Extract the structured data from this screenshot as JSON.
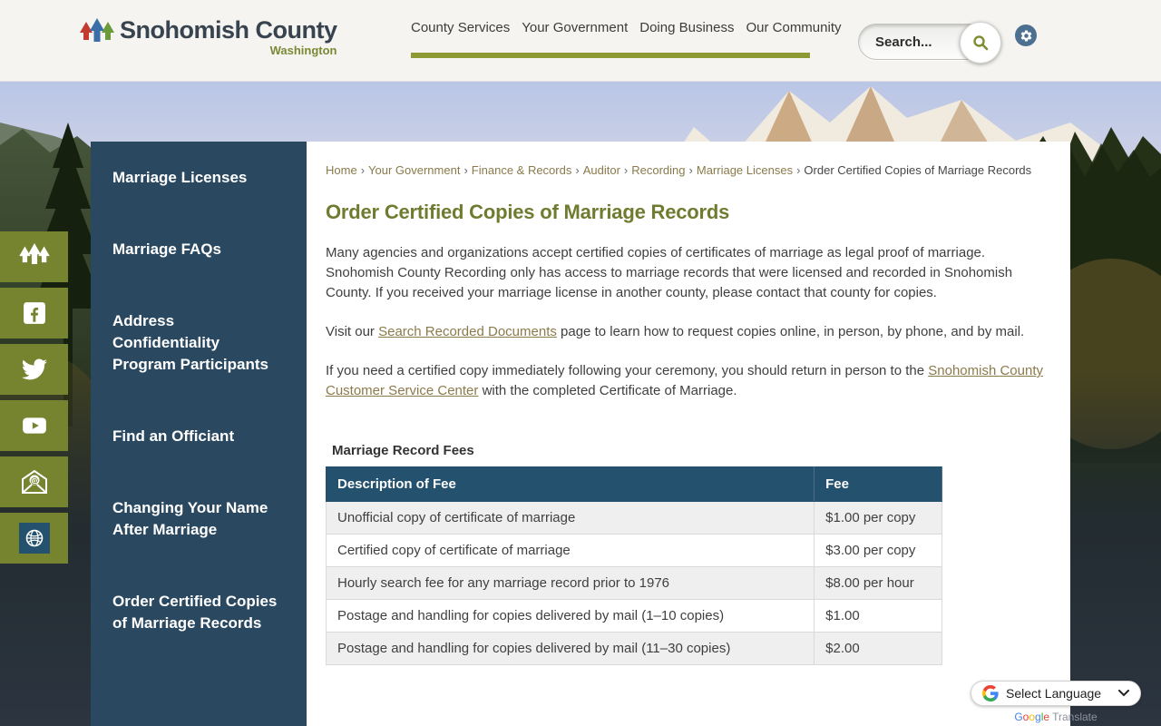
{
  "header": {
    "logo_title": "Snohomish County",
    "logo_subtitle": "Washington",
    "nav": [
      {
        "label": "County Services"
      },
      {
        "label": "Your Government"
      },
      {
        "label": "Doing Business"
      },
      {
        "label": "Our Community"
      }
    ],
    "search_placeholder": "Search..."
  },
  "social_icons": [
    "county-trees",
    "facebook",
    "twitter",
    "youtube",
    "email-newsletter",
    "translate-globe"
  ],
  "sidebar": {
    "items": [
      {
        "label": "Marriage Licenses"
      },
      {
        "label": "Marriage FAQs"
      },
      {
        "label": "Address Confidentiality Program Participants"
      },
      {
        "label": "Find an Officiant"
      },
      {
        "label": "Changing Your Name After Marriage"
      },
      {
        "label": "Order Certified Copies of Marriage Records"
      }
    ]
  },
  "breadcrumb": {
    "separator": "›",
    "links": [
      {
        "label": "Home"
      },
      {
        "label": "Your Government"
      },
      {
        "label": "Finance & Records"
      },
      {
        "label": "Auditor"
      },
      {
        "label": "Recording"
      },
      {
        "label": "Marriage Licenses"
      }
    ],
    "current": "Order Certified Copies of Marriage Records"
  },
  "content": {
    "title": "Order Certified Copies of Marriage Records",
    "p1": "Many agencies and organizations accept certified copies of certificates of marriage as legal proof of marriage. Snohomish County Recording only has access to marriage records that were licensed and recorded in Snohomish County. If you received your marriage license in another county, please contact that county for copies.",
    "p2_before": "Visit our ",
    "p2_link": "Search Recorded Documents",
    "p2_after": " page to learn how to request copies online, in person, by phone, and by mail.",
    "p3_before": "If you need a certified copy immediately following your ceremony, you should return in person to the ",
    "p3_link": "Snohomish County Customer Service Center",
    "p3_after": " with the completed Certificate of Marriage.",
    "table": {
      "caption": "Marriage Record Fees",
      "headers": [
        "Description of Fee",
        "Fee"
      ],
      "rows": [
        [
          "Unofficial copy of certificate of marriage",
          "$1.00 per copy"
        ],
        [
          "Certified copy of certificate of marriage",
          "$3.00 per copy"
        ],
        [
          "Hourly search fee for any marriage record prior to 1976",
          "$8.00 per hour"
        ],
        [
          "Postage and handling for copies delivered by mail (1–10 copies)",
          "$1.00"
        ],
        [
          "Postage and handling for copies delivered by mail (11–30 copies)",
          "$2.00"
        ]
      ]
    }
  },
  "translate": {
    "select_label": "Select Language",
    "brand_letters": [
      "G",
      "o",
      "o",
      "g",
      "l",
      "e"
    ],
    "brand_word": "Translate"
  },
  "colors": {
    "accent_olive": "#76842f",
    "nav_bar_green": "#8d9a33",
    "sidebar_navy": "#2a4961",
    "table_header_blue": "#24516d",
    "heading_olive": "#6f7c2f",
    "link_tan": "#8c7a4a"
  }
}
